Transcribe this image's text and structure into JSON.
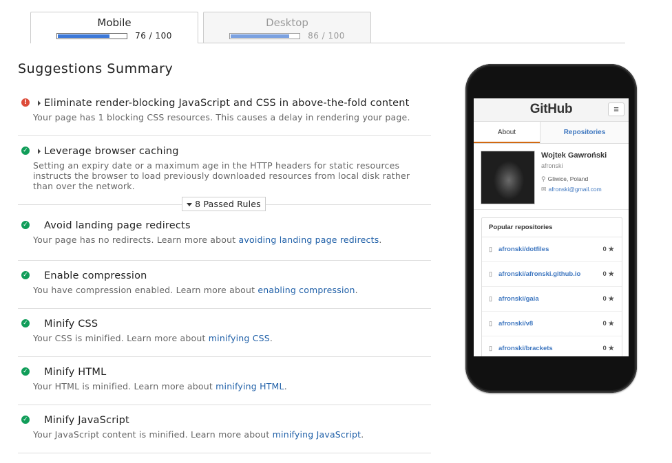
{
  "tabs": [
    {
      "label": "Mobile",
      "score": "76 / 100",
      "score_value": 76
    },
    {
      "label": "Desktop",
      "score": "86 / 100",
      "score_value": 86
    }
  ],
  "summary_title": "Suggestions Summary",
  "rules_top": [
    {
      "status": "error-icon",
      "title": "Eliminate render-blocking JavaScript and CSS in above-the-fold content",
      "desc": "Your page has 1 blocking CSS resources. This causes a delay in rendering your page."
    },
    {
      "status": "check-icon",
      "title": "Leverage browser caching",
      "desc": "Setting an expiry date or a maximum age in the HTTP headers for static resources instructs the browser to load previously downloaded resources from local disk rather than over the network."
    }
  ],
  "passed_toggle": "8 Passed Rules",
  "passed_rules": [
    {
      "title": "Avoid landing page redirects",
      "desc_pre": "Your page has no redirects. Learn more about ",
      "link": "avoiding landing page redirects",
      "desc_post": "."
    },
    {
      "title": "Enable compression",
      "desc_pre": "You have compression enabled. Learn more about ",
      "link": "enabling compression",
      "desc_post": "."
    },
    {
      "title": "Minify CSS",
      "desc_pre": "Your CSS is minified. Learn more about ",
      "link": "minifying CSS",
      "desc_post": "."
    },
    {
      "title": "Minify HTML",
      "desc_pre": "Your HTML is minified. Learn more about ",
      "link": "minifying HTML",
      "desc_post": "."
    },
    {
      "title": "Minify JavaScript",
      "desc_pre": "Your JavaScript content is minified. Learn more about ",
      "link": "minifying JavaScript",
      "desc_post": "."
    }
  ],
  "preview": {
    "logo": "GitHub",
    "menu_icon": "≡",
    "tab_about": "About",
    "tab_repos": "Repositories",
    "name": "Wojtek Gawroński",
    "login": "afronski",
    "location": "Gliwice, Poland",
    "email": "afronski@gmail.com",
    "popular_title": "Popular repositories",
    "repos": [
      {
        "name": "afronski/dotfiles",
        "stars": "0 ★"
      },
      {
        "name": "afronski/afronski.github.io",
        "stars": "0 ★"
      },
      {
        "name": "afronski/gaia",
        "stars": "0 ★"
      },
      {
        "name": "afronski/v8",
        "stars": "0 ★"
      },
      {
        "name": "afronski/brackets",
        "stars": "0 ★"
      }
    ]
  }
}
